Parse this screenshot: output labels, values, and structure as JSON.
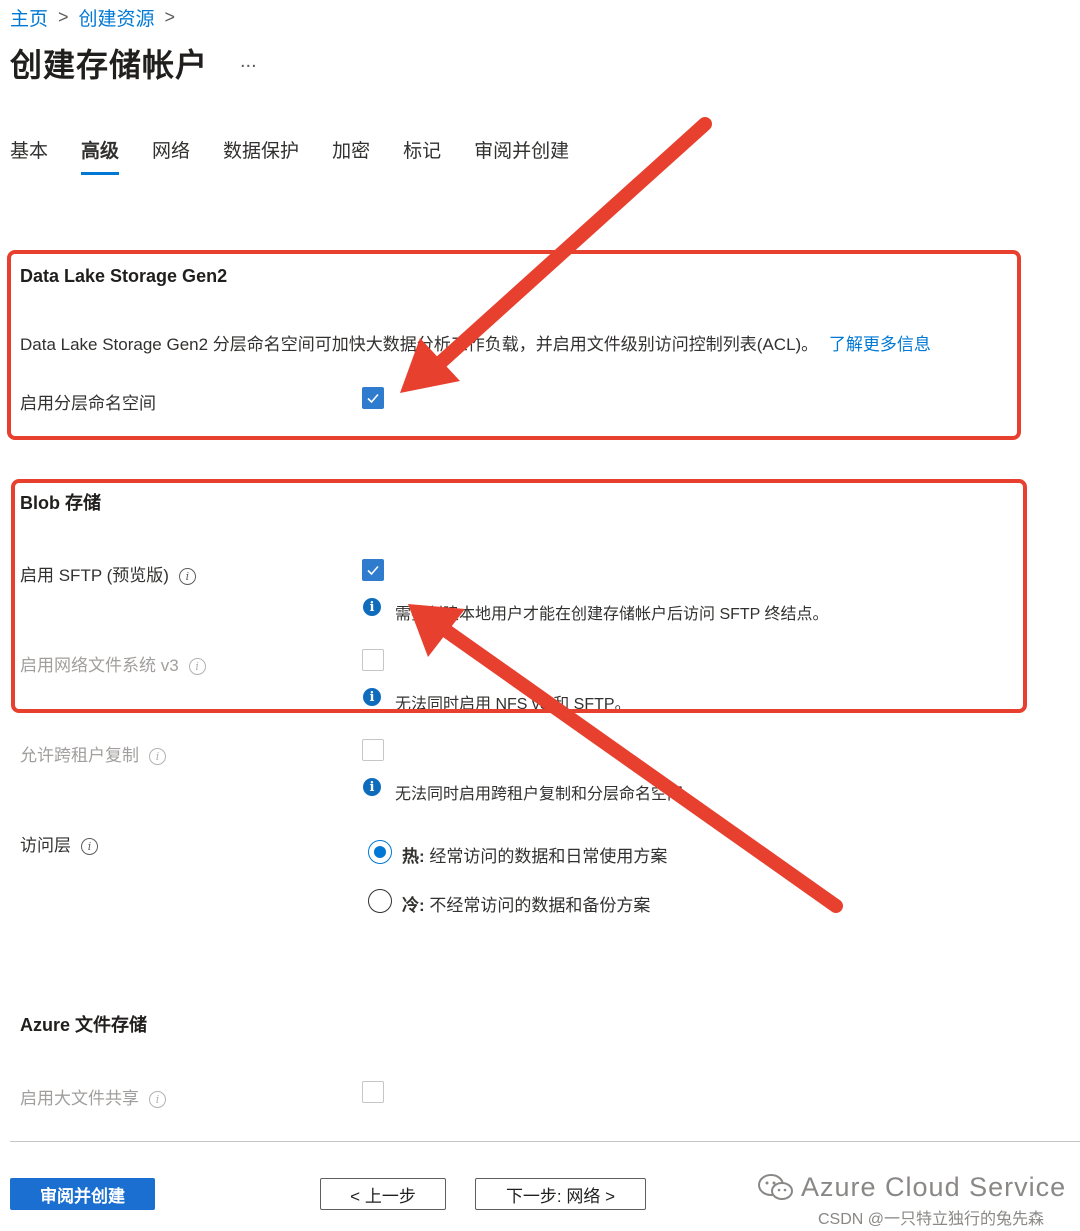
{
  "breadcrumb": {
    "home": "主页",
    "create": "创建资源"
  },
  "page": {
    "title": "创建存储帐户",
    "more": "..."
  },
  "tabs": [
    "基本",
    "高级",
    "网络",
    "数据保护",
    "加密",
    "标记",
    "审阅并创建"
  ],
  "datalake": {
    "title": "Data Lake Storage Gen2",
    "description": "Data Lake Storage Gen2 分层命名空间可加快大数据分析工作负载，并启用文件级别访问控制列表(ACL)。",
    "learn_more": "了解更多信息",
    "hns_label": "启用分层命名空间"
  },
  "blob": {
    "title": "Blob 存储",
    "sftp_label": "启用 SFTP (预览版)",
    "sftp_note": "需要创建本地用户才能在创建存储帐户后访问 SFTP 终结点。",
    "nfs_label": "启用网络文件系统 v3",
    "nfs_note": "无法同时启用 NFS v3 和 SFTP。",
    "cross_tenant_label": "允许跨租户复制",
    "cross_tenant_note": "无法同时启用跨租户复制和分层命名空间。",
    "access_tier_label": "访问层",
    "hot_label": "热:",
    "hot_desc": "经常访问的数据和日常使用方案",
    "cool_label": "冷:",
    "cool_desc": "不经常访问的数据和备份方案"
  },
  "files": {
    "title": "Azure 文件存储",
    "large_share_label": "启用大文件共享"
  },
  "footer": {
    "review_create": "审阅并创建",
    "previous": "< 上一步",
    "next": "下一步: 网络 >"
  },
  "watermark": {
    "line1": "Azure Cloud Service",
    "line2": "CSDN @一只特立独行的兔先森"
  },
  "colors": {
    "accent": "#0078d4",
    "annotation": "#e8402e"
  },
  "icons": {
    "info": "info-icon",
    "check": "check-icon",
    "chevron": "chevron-right-icon"
  }
}
